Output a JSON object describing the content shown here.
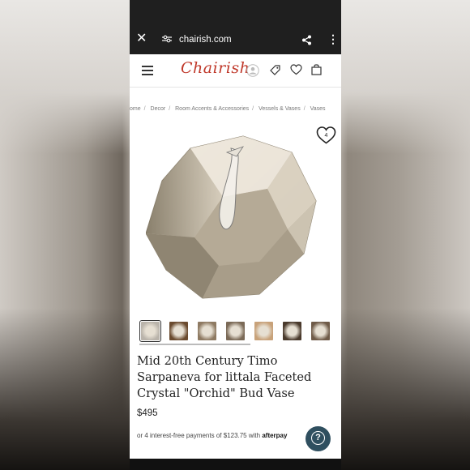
{
  "browser": {
    "url": "chairish.com",
    "close_icon": "close-icon",
    "share_icon": "share-icon",
    "menu_icon": "more-vert-icon"
  },
  "header": {
    "logo": "Chairish",
    "icons": [
      "hamburger-icon",
      "user-icon",
      "tag-icon",
      "heart-icon",
      "bag-icon"
    ]
  },
  "breadcrumbs": [
    "ome",
    "Decor",
    "Room Accents & Accessories",
    "Vessels & Vases",
    "Vases"
  ],
  "favorite": {
    "count": "4"
  },
  "product": {
    "title": "Mid 20th Century Timo Sarpaneva for littala Faceted Crystal \"Orchid\" Bud Vase",
    "price": "$495",
    "installments": "or 4 interest-free payments of $123.75 with",
    "afterpay": "afterpay"
  },
  "thumbnails": [
    {
      "tone": "#b9b3aa"
    },
    {
      "tone": "#6a4a2e"
    },
    {
      "tone": "#8e7a62"
    },
    {
      "tone": "#7b6a57"
    },
    {
      "tone": "#c8a27a"
    },
    {
      "tone": "#4a3a2c"
    },
    {
      "tone": "#6f5b48"
    }
  ],
  "colors": {
    "brand": "#c0392b",
    "help_button": "#2f4f5f"
  }
}
